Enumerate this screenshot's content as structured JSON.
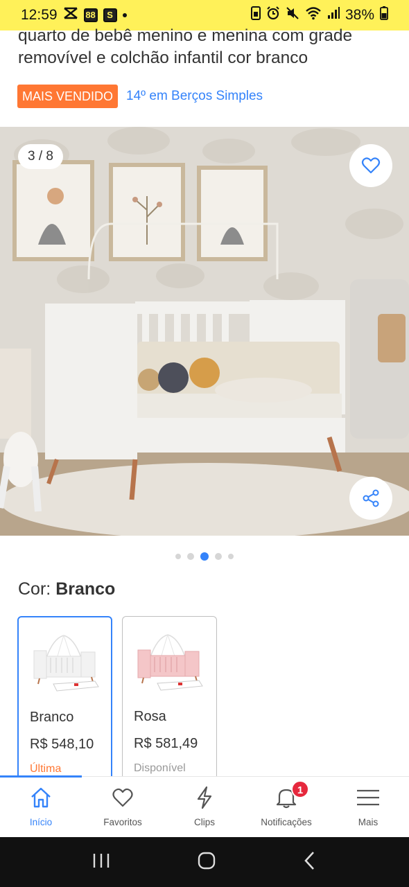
{
  "status_bar": {
    "time": "12:59",
    "battery": "38%"
  },
  "product": {
    "title": "quarto de bebê menino e menina com grade removível e colchão infantil cor branco",
    "badge": "MAIS VENDIDO",
    "rank": "14º em Berços Simples"
  },
  "gallery": {
    "counter": "3 / 8",
    "dot_count": 5,
    "active_dot": 2
  },
  "color": {
    "label": "Cor:",
    "selected": "Branco"
  },
  "variants": [
    {
      "name": "Branco",
      "price": "R$ 548,10",
      "stock": "Última",
      "stock_color": "#ff7733",
      "crib_color": "#f2f2f2"
    },
    {
      "name": "Rosa",
      "price": "R$ 581,49",
      "stock": "Disponível",
      "stock_color": "#999999",
      "crib_color": "#f4c6c8"
    }
  ],
  "bottom_nav": {
    "items": [
      {
        "label": "Início",
        "icon": "home-icon"
      },
      {
        "label": "Favoritos",
        "icon": "heart-icon"
      },
      {
        "label": "Clips",
        "icon": "lightning-icon"
      },
      {
        "label": "Notificações",
        "icon": "bell-icon",
        "badge": "1"
      },
      {
        "label": "Mais",
        "icon": "menu-icon"
      }
    ]
  },
  "colors": {
    "accent": "#3483fa",
    "badge_orange": "#ff7733",
    "status_yellow": "#fff159",
    "notif_red": "#e6283d"
  }
}
